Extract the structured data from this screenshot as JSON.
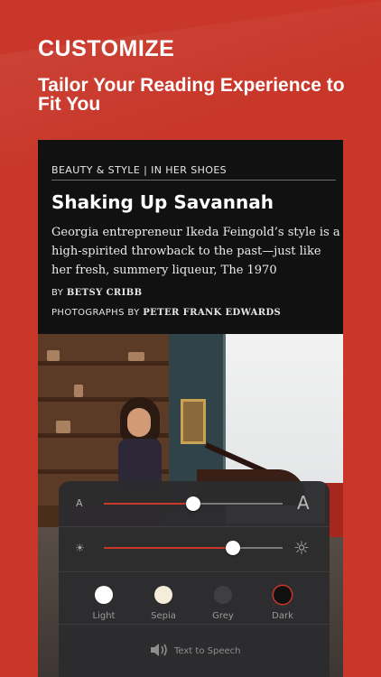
{
  "promo": {
    "headline": "CUSTOMIZE",
    "tagline": "Tailor Your Reading Experience to Fit You"
  },
  "article": {
    "section": "BEAUTY & STYLE | IN HER SHOES",
    "title": "Shaking Up Savannah",
    "deck": "Georgia entrepreneur Ikeda Feingold’s style is a high-spirited throwback to the past—just like her fresh, summery liqueur, The 1970",
    "byline_prefix": "BY ",
    "author": "BETSY CRIBB",
    "photos_prefix": "PHOTOGRAPHS BY ",
    "photographer": "PETER FRANK EDWARDS"
  },
  "settings": {
    "font_size": {
      "min_label": "A",
      "max_label": "A",
      "level": 0.5,
      "min_icon": "text-small-icon",
      "max_icon": "text-large-icon"
    },
    "brightness": {
      "level": 0.72,
      "min_icon": "brightness-low-icon",
      "max_icon": "brightness-high-icon"
    },
    "themes": [
      {
        "label": "Light",
        "color": "#ffffff"
      },
      {
        "label": "Sepia",
        "color": "#f5ecd9"
      },
      {
        "label": "Grey",
        "color": "#3f3f41"
      },
      {
        "label": "Dark",
        "color": "#111111",
        "selected": true
      }
    ],
    "tts_label": "Text to Speech",
    "tts_icon": "speaker-icon",
    "accent_color": "#c8372a"
  },
  "colors": {
    "background": "#c8372a",
    "reader_background": "#111111"
  }
}
